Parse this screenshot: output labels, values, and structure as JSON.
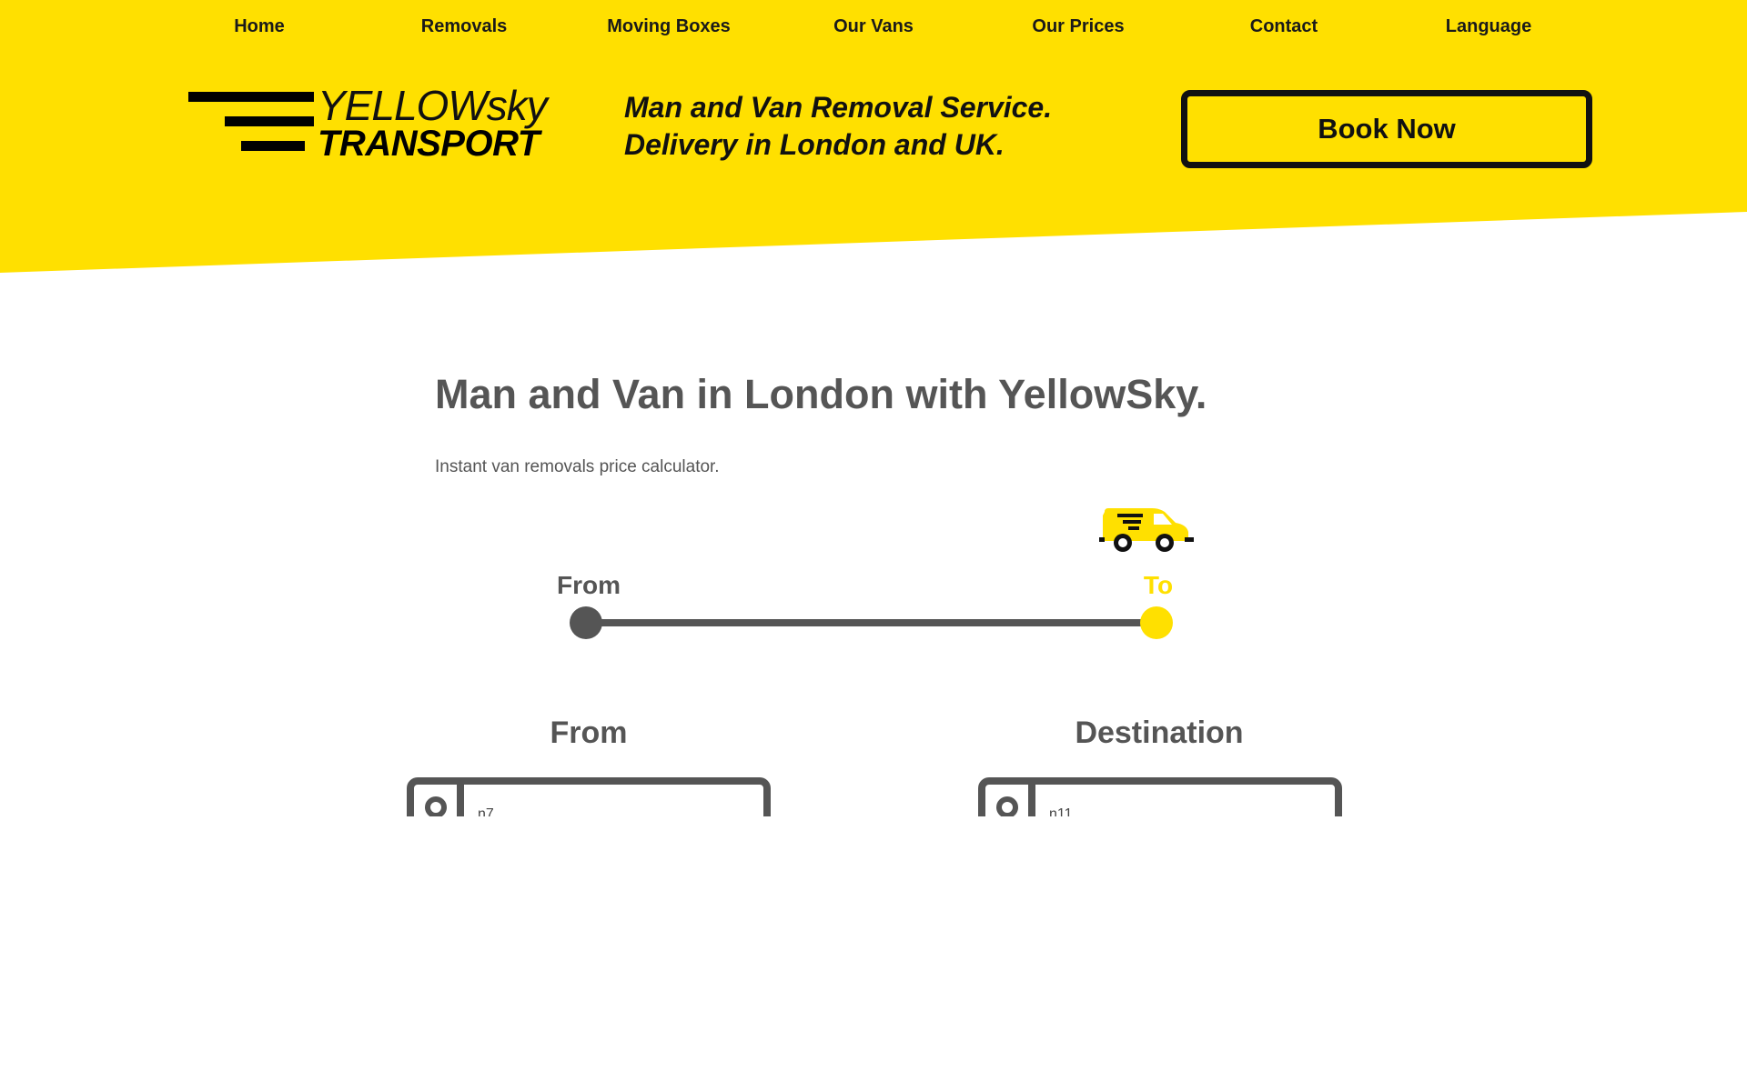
{
  "nav": {
    "items": [
      {
        "label": "Home"
      },
      {
        "label": "Removals"
      },
      {
        "label": "Moving Boxes"
      },
      {
        "label": "Our Vans"
      },
      {
        "label": "Our Prices"
      },
      {
        "label": "Contact"
      },
      {
        "label": "Language"
      }
    ]
  },
  "logo": {
    "line1": "YELLOWsky",
    "line2": "TRANSPORT"
  },
  "header": {
    "tagline": "Man and Van Removal Service. Delivery in London and UK.",
    "book_button": "Book Now"
  },
  "main": {
    "title": "Man and Van in London with YellowSky.",
    "subtitle": "Instant van removals price calculator."
  },
  "stepper": {
    "from_label": "From",
    "to_label": "To",
    "icon": "van-icon"
  },
  "form": {
    "from": {
      "heading": "From",
      "value": "n7"
    },
    "destination": {
      "heading": "Destination",
      "value": "n11"
    }
  },
  "colors": {
    "brand_yellow": "#FFE000",
    "text_gray": "#555555",
    "black": "#111111"
  }
}
